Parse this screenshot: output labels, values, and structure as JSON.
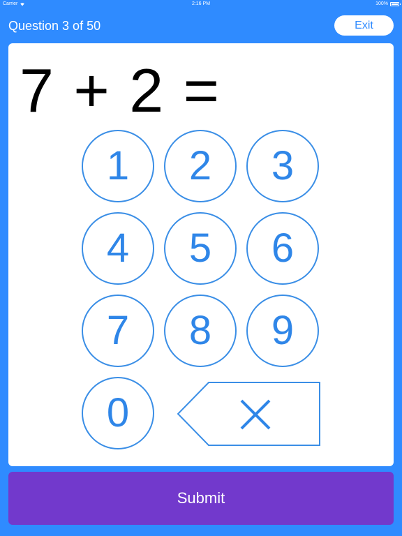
{
  "status_bar": {
    "carrier": "Carrier",
    "time": "2:16 PM",
    "battery": "100%"
  },
  "header": {
    "question_label": "Question 3 of 50",
    "exit_label": "Exit"
  },
  "question": {
    "equation": "7 + 2 ="
  },
  "keypad": {
    "keys": [
      "1",
      "2",
      "3",
      "4",
      "5",
      "6",
      "7",
      "8",
      "9",
      "0"
    ],
    "backspace_icon": "delete-icon"
  },
  "footer": {
    "submit_label": "Submit"
  },
  "colors": {
    "background": "#2f8bff",
    "key_accent": "#2f86e8",
    "submit": "#7239cc"
  }
}
